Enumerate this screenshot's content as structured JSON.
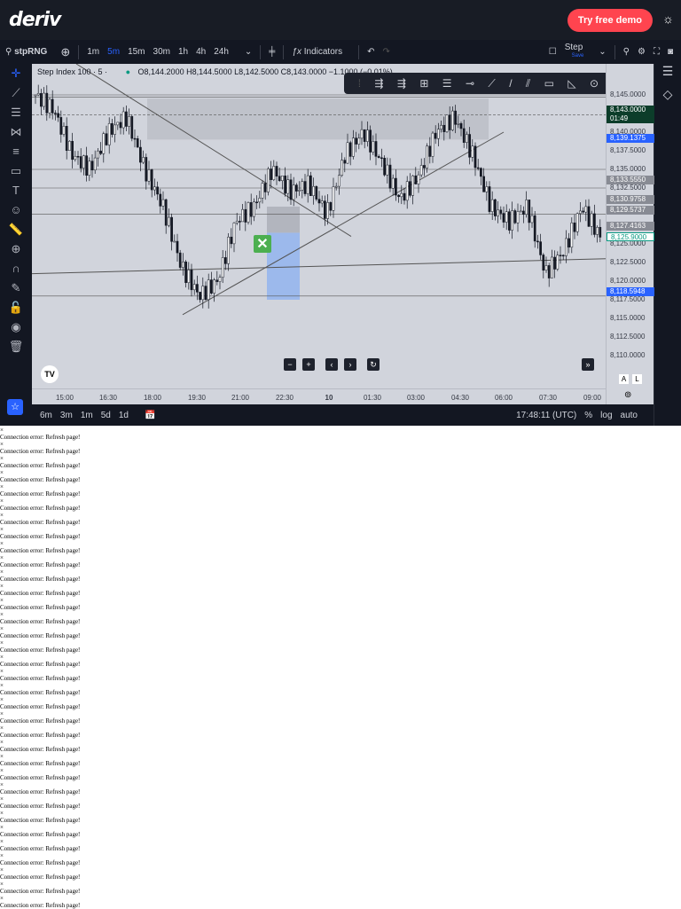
{
  "header": {
    "logo": "deriv",
    "demo_button": "Try free demo"
  },
  "toolbar": {
    "symbol": "stpRNG",
    "intervals": [
      "1m",
      "5m",
      "15m",
      "30m",
      "1h",
      "4h",
      "24h"
    ],
    "active_interval": "5m",
    "indicators": "Indicators",
    "step_label": "Step",
    "step_sub": "Save"
  },
  "legend": {
    "title": "Step Index 100 · 5 ·",
    "ohlc": "O8,144.2000 H8,144.5000 L8,142.5000 C8,143.0000 −1.1000 (−0.01%)"
  },
  "price_axis": {
    "labels": [
      "8,145.0000",
      "8,140.0000",
      "8,137.5000",
      "8,135.0000",
      "8,132.5000",
      "8,125.0000",
      "8,122.5000",
      "8,120.0000",
      "8,117.5000",
      "8,115.0000",
      "8,112.5000",
      "8,110.0000"
    ],
    "badges": [
      {
        "text": "8,143.0000",
        "sub": "01:49",
        "color": "#0c3d2a"
      },
      {
        "text": "8,139.1375",
        "color": "#2962ff"
      },
      {
        "text": "8,133.5550",
        "color": "#888b94"
      },
      {
        "text": "8,130.9758",
        "color": "#888b94"
      },
      {
        "text": "8,129.5737",
        "color": "#888b94"
      },
      {
        "text": "8,127.4163",
        "color": "#888b94"
      },
      {
        "text": "8,125.9000",
        "color": "#ffffff"
      },
      {
        "text": "8,118.5948",
        "color": "#2962ff"
      }
    ],
    "a_label": "A",
    "l_label": "L"
  },
  "time_axis": [
    "15:00",
    "16:30",
    "18:00",
    "19:30",
    "21:00",
    "22:30",
    "10",
    "01:30",
    "03:00",
    "04:30",
    "06:00",
    "07:30",
    "09:00"
  ],
  "footer": {
    "ranges": [
      "6m",
      "3m",
      "1m",
      "5d",
      "1d"
    ],
    "clock": "17:48:11 (UTC)",
    "percent": "%",
    "log": "log",
    "auto": "auto"
  },
  "chart_data": {
    "type": "candlestick",
    "series_approx_close": [
      8145,
      8143,
      8137,
      8135,
      8140,
      8142,
      8135,
      8130,
      8122,
      8118,
      8120,
      8128,
      8130,
      8135,
      8132,
      8133,
      8129,
      8137,
      8140,
      8136,
      8131,
      8134,
      8140,
      8142,
      8137,
      8130,
      8128,
      8130,
      8121,
      8124,
      8130,
      8126
    ],
    "ylim": [
      8107,
      8148
    ]
  },
  "error": {
    "close": "×",
    "message": "Connection error: Refresh page!",
    "count": 34
  }
}
